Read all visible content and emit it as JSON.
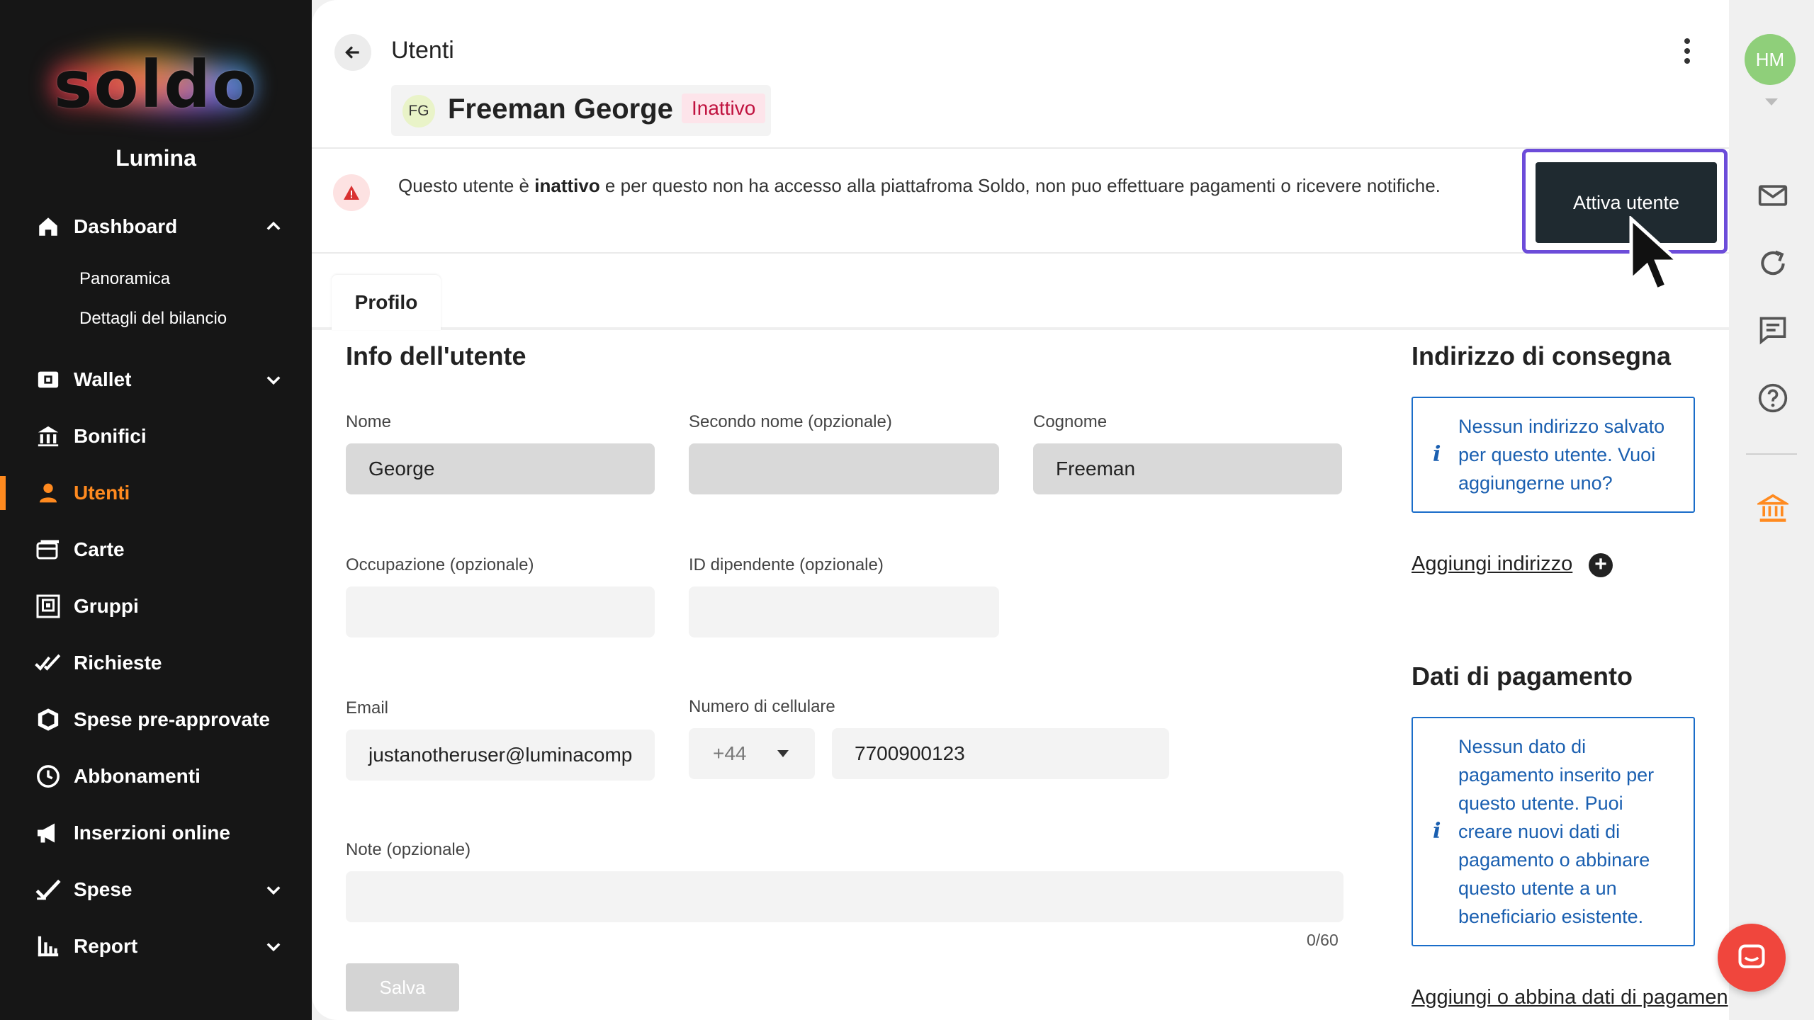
{
  "sidebar": {
    "brand": "soldo",
    "company": "Lumina",
    "items": [
      {
        "label": "Dashboard",
        "icon": "home-icon"
      },
      {
        "label": "Panoramica"
      },
      {
        "label": "Dettagli del bilancio"
      },
      {
        "label": "Wallet",
        "icon": "wallet-icon"
      },
      {
        "label": "Bonifici",
        "icon": "bank-transfer-icon"
      },
      {
        "label": "Utenti",
        "icon": "user-icon",
        "active": true
      },
      {
        "label": "Carte",
        "icon": "cards-icon"
      },
      {
        "label": "Gruppi",
        "icon": "groups-icon"
      },
      {
        "label": "Richieste",
        "icon": "double-check-icon"
      },
      {
        "label": "Spese pre-approvate",
        "icon": "shield-icon"
      },
      {
        "label": "Abbonamenti",
        "icon": "clock-icon"
      },
      {
        "label": "Inserzioni online",
        "icon": "megaphone-icon"
      },
      {
        "label": "Spese",
        "icon": "check-icon"
      },
      {
        "label": "Report",
        "icon": "chart-icon"
      }
    ],
    "active_color": "#ff8a1f"
  },
  "header": {
    "title": "Utenti",
    "user_initials": "FG",
    "user_name": "Freeman George",
    "status": "Inattivo"
  },
  "alert": {
    "text_before": "Questo utente è ",
    "text_bold": "inattivo",
    "text_after": " e per questo non ha accesso alla piattafroma Soldo, non puo effettuare pagamenti o ricevere notifiche.",
    "button_label": "Attiva utente"
  },
  "tabs": [
    {
      "label": "Profilo"
    }
  ],
  "info": {
    "title": "Info dell'utente",
    "first_name_label": "Nome",
    "first_name_value": "George",
    "middle_name_label": "Secondo nome (opzionale)",
    "middle_name_value": "",
    "last_name_label": "Cognome",
    "last_name_value": "Freeman",
    "occupation_label": "Occupazione (opzionale)",
    "occupation_value": "",
    "employee_id_label": "ID dipendente (opzionale)",
    "employee_id_value": "",
    "email_label": "Email",
    "email_value": "justanotheruser@luminacomp",
    "phone_label": "Numero di cellulare",
    "phone_prefix": "+44",
    "phone_value": "7700900123",
    "notes_label": "Note (opzionale)",
    "notes_value": "",
    "notes_counter": "0/60",
    "save_label": "Salva"
  },
  "address": {
    "title": "Indirizzo di consegna",
    "empty_line1": "Nessun indirizzo salvato",
    "empty_line2": "per questo utente. Vuoi",
    "empty_line3": "aggiungerne uno?",
    "add_link": "Aggiungi indirizzo"
  },
  "payment": {
    "title": "Dati di pagamento",
    "lines": [
      "Nessun dato di",
      "pagamento inserito per",
      "questo utente. Puoi",
      "creare nuovi dati di",
      "pagamento o abbinare",
      "questo utente a un",
      "beneficiario esistente."
    ],
    "add_link": "Aggiungi o abbina dati di pagamen"
  },
  "rightbar": {
    "initials": "HM"
  }
}
